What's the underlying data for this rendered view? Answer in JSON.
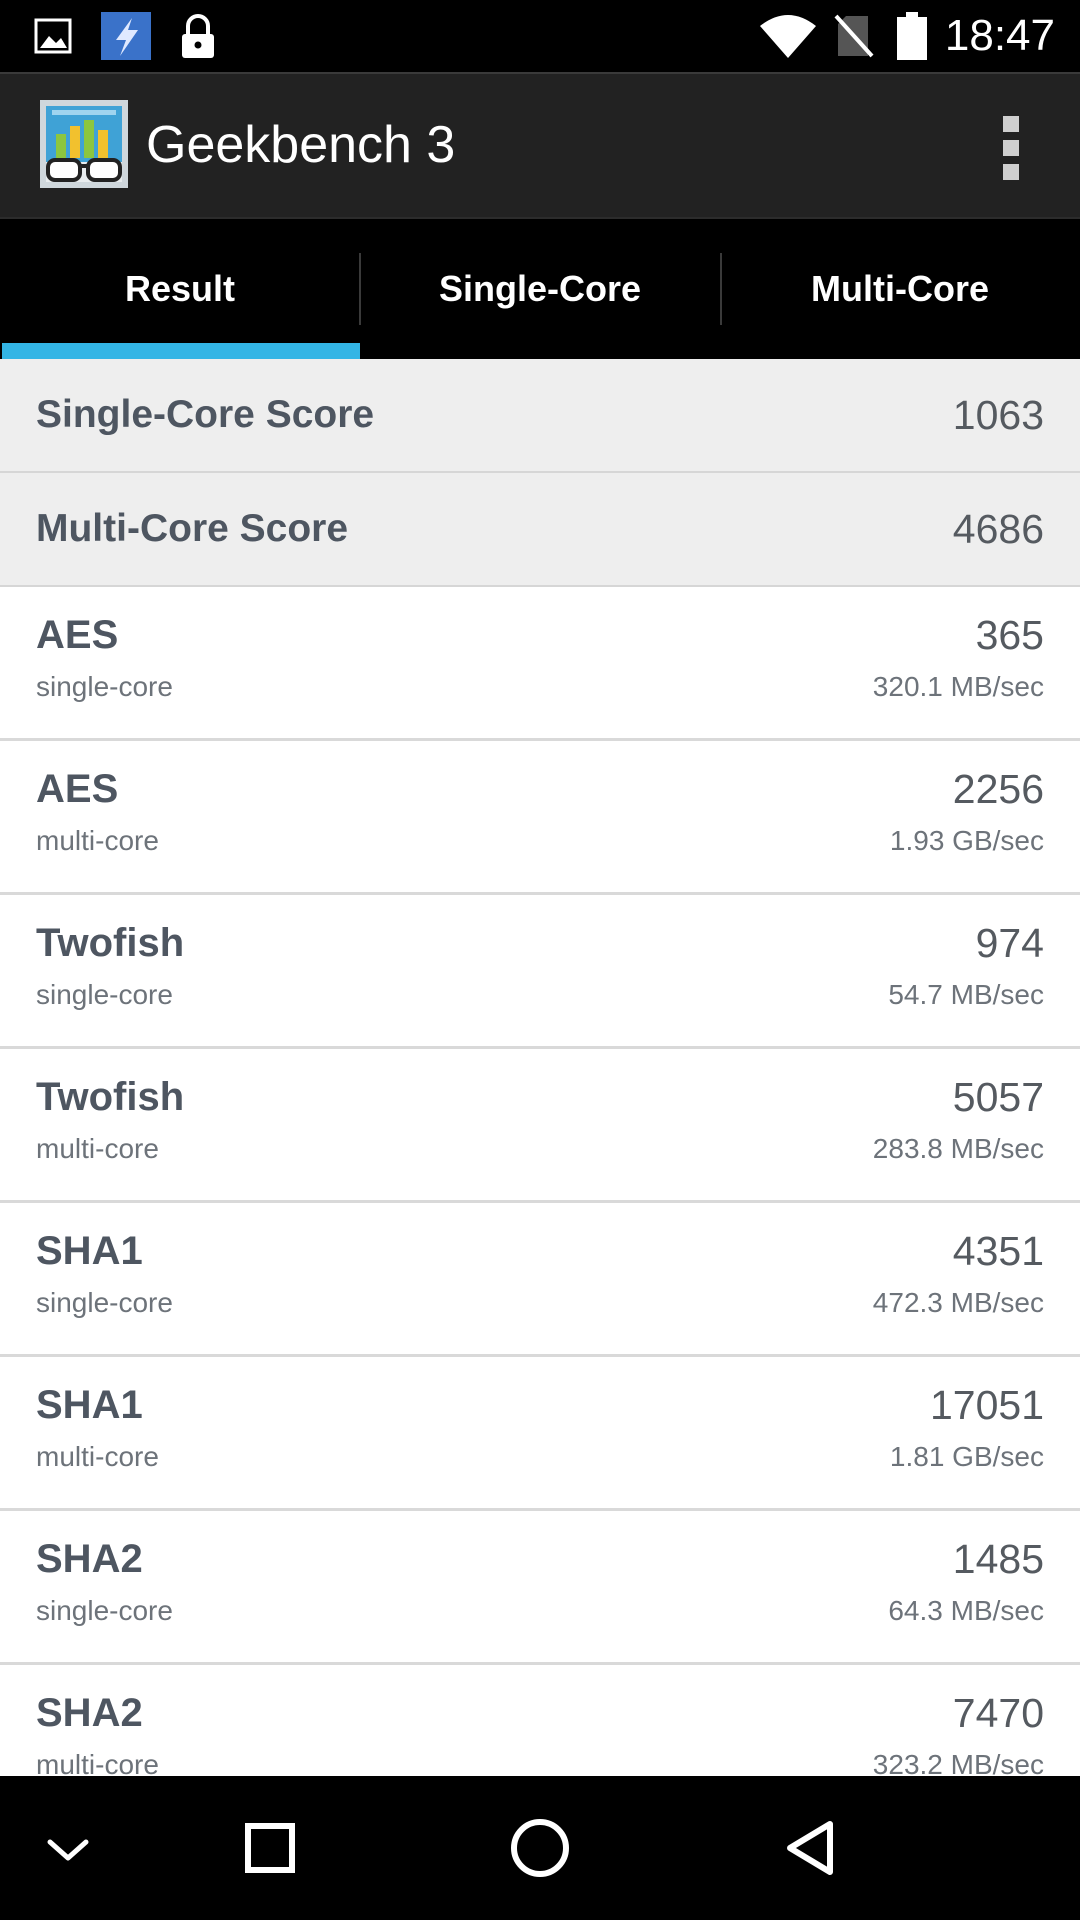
{
  "status_bar": {
    "time": "18:47",
    "left_icons": [
      "image-notification-icon",
      "app-notification-icon",
      "lock-icon"
    ],
    "right_icons": [
      "wifi-icon",
      "no-sim-icon",
      "battery-icon"
    ]
  },
  "app_bar": {
    "title": "Geekbench 3",
    "menu_icon": "overflow-menu-icon"
  },
  "tabs": [
    {
      "label": "Result",
      "selected": true
    },
    {
      "label": "Single-Core",
      "selected": false
    },
    {
      "label": "Multi-Core",
      "selected": false
    }
  ],
  "accent_color": "#33b5e5",
  "scores": [
    {
      "label": "Single-Core Score",
      "value": "1063"
    },
    {
      "label": "Multi-Core Score",
      "value": "4686"
    }
  ],
  "benchmarks": [
    {
      "name": "AES",
      "mode": "single-core",
      "score": "365",
      "rate": "320.1 MB/sec"
    },
    {
      "name": "AES",
      "mode": "multi-core",
      "score": "2256",
      "rate": "1.93 GB/sec"
    },
    {
      "name": "Twofish",
      "mode": "single-core",
      "score": "974",
      "rate": "54.7 MB/sec"
    },
    {
      "name": "Twofish",
      "mode": "multi-core",
      "score": "5057",
      "rate": "283.8 MB/sec"
    },
    {
      "name": "SHA1",
      "mode": "single-core",
      "score": "4351",
      "rate": "472.3 MB/sec"
    },
    {
      "name": "SHA1",
      "mode": "multi-core",
      "score": "17051",
      "rate": "1.81 GB/sec"
    },
    {
      "name": "SHA2",
      "mode": "single-core",
      "score": "1485",
      "rate": "64.3 MB/sec"
    },
    {
      "name": "SHA2",
      "mode": "multi-core",
      "score": "7470",
      "rate": "323.2 MB/sec"
    }
  ],
  "nav_bar": {
    "buttons": [
      "hide-keyboard-icon",
      "recents-icon",
      "home-icon",
      "back-icon"
    ]
  }
}
